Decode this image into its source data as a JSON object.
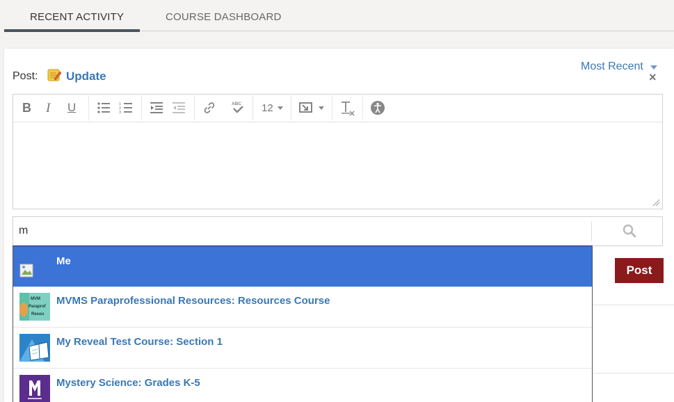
{
  "tabs": [
    {
      "label": "RECENT ACTIVITY",
      "active": true
    },
    {
      "label": "COURSE DASHBOARD",
      "active": false
    }
  ],
  "composer": {
    "post_label": "Post:",
    "update_label": "Update",
    "sort_label": "Most Recent",
    "close_glyph": "×"
  },
  "toolbar": {
    "bold": "B",
    "italic": "I",
    "underline": "U",
    "font_size": "12"
  },
  "search": {
    "value": "m"
  },
  "post_button_label": "Post",
  "dropdown": {
    "items": [
      {
        "label": "Me",
        "selected": true
      },
      {
        "label": "MVMS Paraprofessional Resources: Resources Course",
        "selected": false
      },
      {
        "label": "My Reveal Test Course: Section 1",
        "selected": false
      },
      {
        "label": "Mystery Science: Grades K-5",
        "selected": false
      }
    ]
  },
  "colors": {
    "accent": "#3a78b5",
    "selected_bg": "#3b73d6",
    "post_button": "#8a1a1c"
  }
}
